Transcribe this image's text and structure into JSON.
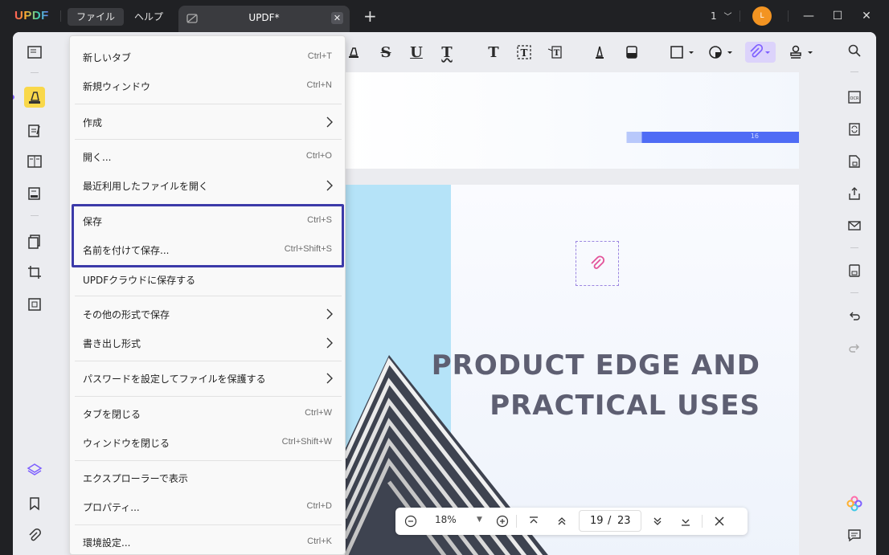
{
  "app": {
    "logo": "UPDF",
    "menus": {
      "file": "ファイル",
      "help": "ヘルプ"
    },
    "tab_title": "UPDF*",
    "window_count": "1",
    "avatar_initial": "L"
  },
  "file_menu": {
    "items": [
      {
        "label": "新しいタブ",
        "shortcut": "Ctrl+T"
      },
      {
        "label": "新規ウィンドウ",
        "shortcut": "Ctrl+N"
      },
      {
        "label": "作成",
        "shortcut": ""
      },
      {
        "label": "開く...",
        "shortcut": "Ctrl+O"
      },
      {
        "label": "最近利用したファイルを開く",
        "shortcut": ""
      },
      {
        "label": "保存",
        "shortcut": "Ctrl+S"
      },
      {
        "label": "名前を付けて保存...",
        "shortcut": "Ctrl+Shift+S"
      },
      {
        "label": "UPDFクラウドに保存する",
        "shortcut": ""
      },
      {
        "label": "その他の形式で保存",
        "shortcut": ""
      },
      {
        "label": "書き出し形式",
        "shortcut": ""
      },
      {
        "label": "パスワードを設定してファイルを保護する",
        "shortcut": ""
      },
      {
        "label": "タブを閉じる",
        "shortcut": "Ctrl+W"
      },
      {
        "label": "ウィンドウを閉じる",
        "shortcut": "Ctrl+Shift+W"
      },
      {
        "label": "エクスプローラーで表示",
        "shortcut": ""
      },
      {
        "label": "プロパティ...",
        "shortcut": "Ctrl+D"
      },
      {
        "label": "環境設定...",
        "shortcut": "Ctrl+K"
      }
    ]
  },
  "document": {
    "page1_number": "16",
    "headline_line1": "PRODUCT EDGE AND",
    "headline_line2": "PRACTICAL USES"
  },
  "zoom": {
    "value": "18%",
    "current_page": "19",
    "page_separator": "/",
    "total_pages": "23"
  },
  "colors": {
    "highlight_border": "#3c3aa9",
    "accent_purple": "#7d5fff",
    "ribbon_blue": "#4f6cf5",
    "active_tool_yellow": "#f9d84a"
  }
}
